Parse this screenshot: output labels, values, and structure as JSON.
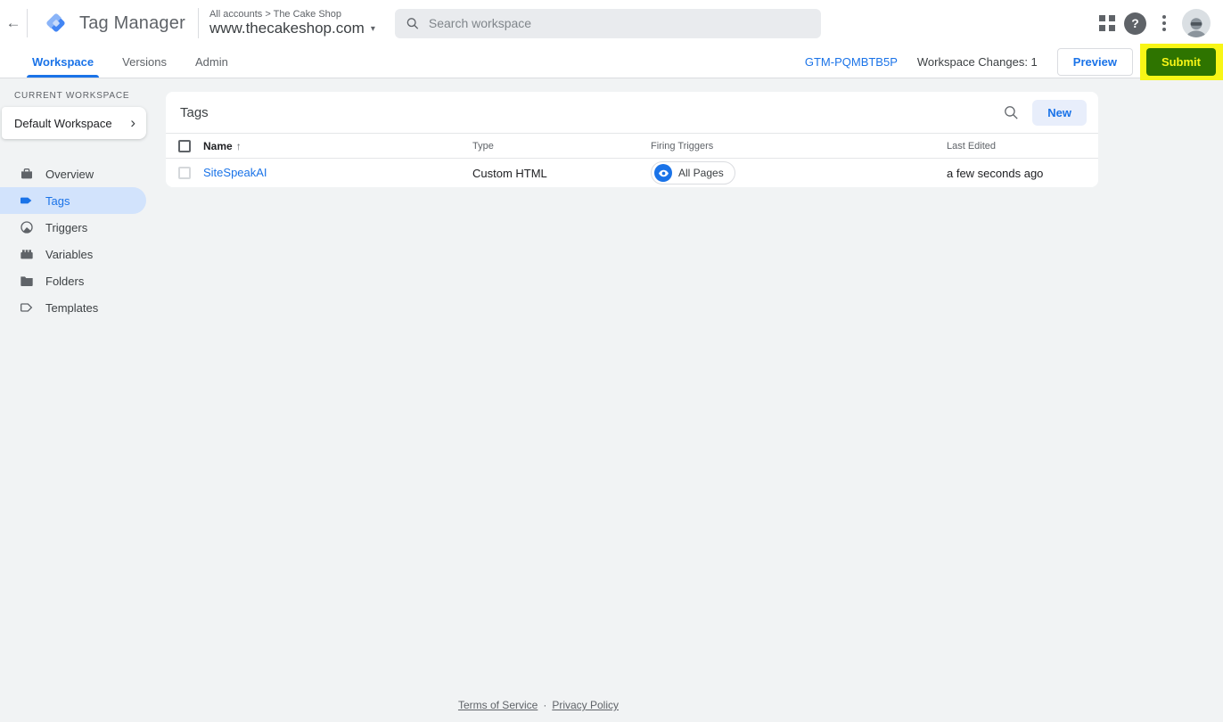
{
  "header": {
    "back_glyph": "←",
    "app_name": "Tag Manager",
    "breadcrumb": "All accounts > The Cake Shop",
    "container_name": "www.thecakeshop.com",
    "container_caret": "▾",
    "search_placeholder": "Search workspace",
    "help_glyph": "?"
  },
  "tabs": [
    {
      "label": "Workspace",
      "active": true
    },
    {
      "label": "Versions",
      "active": false
    },
    {
      "label": "Admin",
      "active": false
    }
  ],
  "toolbar": {
    "container_id": "GTM-PQMBTB5P",
    "workspace_changes": "Workspace Changes: 1",
    "preview_label": "Preview",
    "submit_label": "Submit"
  },
  "sidebar": {
    "section_label": "CURRENT WORKSPACE",
    "workspace_name": "Default Workspace",
    "workspace_chevron": "›",
    "items": [
      {
        "label": "Overview",
        "icon": "overview-icon",
        "active": false
      },
      {
        "label": "Tags",
        "icon": "tag-icon",
        "active": true
      },
      {
        "label": "Triggers",
        "icon": "trigger-icon",
        "active": false
      },
      {
        "label": "Variables",
        "icon": "variables-icon",
        "active": false
      },
      {
        "label": "Folders",
        "icon": "folder-icon",
        "active": false
      },
      {
        "label": "Templates",
        "icon": "template-icon",
        "active": false
      }
    ]
  },
  "main": {
    "panel_title": "Tags",
    "new_button": "New",
    "table": {
      "sort_indicator": "↑",
      "columns": {
        "name": "Name",
        "type": "Type",
        "firing_triggers": "Firing Triggers",
        "last_edited": "Last Edited"
      },
      "rows": [
        {
          "name": "SiteSpeakAI",
          "type": "Custom HTML",
          "firing_triggers": "All Pages",
          "last_edited": "a few seconds ago"
        }
      ]
    }
  },
  "footer": {
    "terms": "Terms of Service",
    "separator": "·",
    "privacy": "Privacy Policy"
  },
  "colors": {
    "accent_blue": "#1a73e8",
    "selected_pill": "#d2e3fc",
    "submit_green": "#2e7400",
    "highlight_yellow": "#f8f616",
    "content_bg": "#f1f3f4"
  }
}
